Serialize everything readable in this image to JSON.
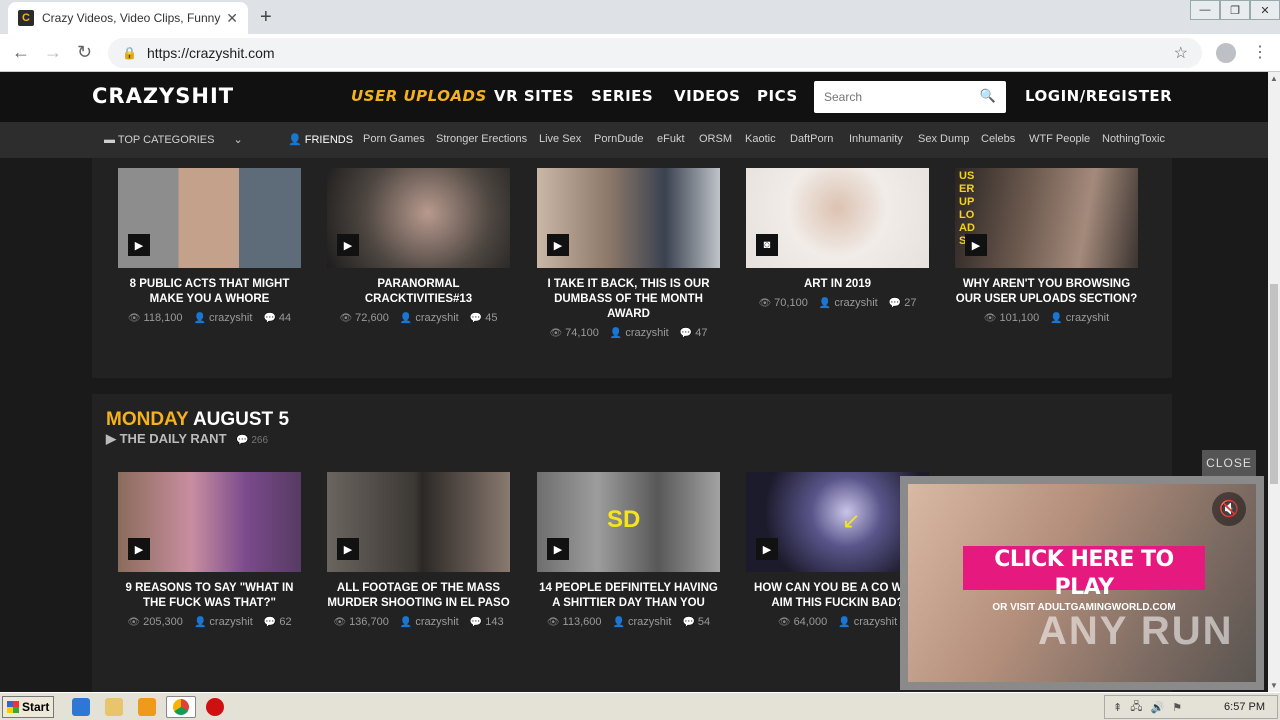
{
  "browser": {
    "tab_title": "Crazy Videos, Video Clips, Funny Vid",
    "url": "https://crazyshit.com"
  },
  "site": {
    "logo": "CRAZYSHIT",
    "nav": [
      {
        "label": "USER UPLOADS"
      },
      {
        "label": "VR SITES"
      },
      {
        "label": "SERIES"
      },
      {
        "label": "VIDEOS"
      },
      {
        "label": "PICS"
      }
    ],
    "search_placeholder": "Search",
    "login": "LOGIN/REGISTER"
  },
  "catbar": {
    "top_categories": "TOP CATEGORIES",
    "friends": "FRIENDS",
    "links": [
      "Porn Games",
      "Stronger Erections",
      "Live Sex",
      "PornDude",
      "eFukt",
      "ORSM",
      "Kaotic",
      "DaftPorn",
      "Inhumanity",
      "Sex Dump",
      "Celebs",
      "WTF People",
      "NothingToxic"
    ]
  },
  "row1": [
    {
      "title": "8 PUBLIC ACTS THAT MIGHT MAKE YOU A WHORE",
      "views": "118,100",
      "user": "crazyshit",
      "comments": "44",
      "type": "video"
    },
    {
      "title": "PARANORMAL CRACKTIVITIES#13",
      "views": "72,600",
      "user": "crazyshit",
      "comments": "45",
      "type": "video"
    },
    {
      "title": "I TAKE IT BACK, THIS IS OUR DUMBASS OF THE MONTH AWARD",
      "views": "74,100",
      "user": "crazyshit",
      "comments": "47",
      "type": "video"
    },
    {
      "title": "ART IN 2019",
      "views": "70,100",
      "user": "crazyshit",
      "comments": "27",
      "type": "pic"
    },
    {
      "title": "WHY AREN'T YOU BROWSING OUR USER UPLOADS SECTION?",
      "views": "101,100",
      "user": "crazyshit",
      "comments": "",
      "type": "video",
      "overlay": "USER UPLOADS"
    }
  ],
  "day": {
    "weekday": "MONDAY",
    "date": "AUGUST 5",
    "rant": "THE DAILY RANT",
    "rant_count": "266"
  },
  "row2": [
    {
      "title": "9 REASONS TO SAY \"WHAT IN THE FUCK WAS THAT?\"",
      "views": "205,300",
      "user": "crazyshit",
      "comments": "62",
      "type": "video"
    },
    {
      "title": "ALL FOOTAGE OF THE MASS MURDER SHOOTING IN EL PASO",
      "views": "136,700",
      "user": "crazyshit",
      "comments": "143",
      "type": "video"
    },
    {
      "title": "14 PEOPLE DEFINITELY HAVING A SHITTIER DAY THAN YOU",
      "views": "113,600",
      "user": "crazyshit",
      "comments": "54",
      "type": "video",
      "overlay": "SD"
    },
    {
      "title": "HOW CAN YOU BE A CO WITH AIM THIS FUCKIN BAD?",
      "views": "64,000",
      "user": "crazyshit",
      "comments": "",
      "type": "video"
    }
  ],
  "ad": {
    "close": "CLOSE",
    "cta": "CLICK HERE TO PLAY",
    "sub": "OR VISIT ADULTGAMINGWORLD.COM",
    "watermark": "ANY RUN"
  },
  "taskbar": {
    "start": "Start",
    "clock": "6:57 PM"
  },
  "colors": {
    "accent": "#f5b21c",
    "header_bg": "#111111",
    "catbar_bg": "#2d2d2d",
    "panel_bg": "#222222",
    "ad_cta": "#e6197e"
  }
}
